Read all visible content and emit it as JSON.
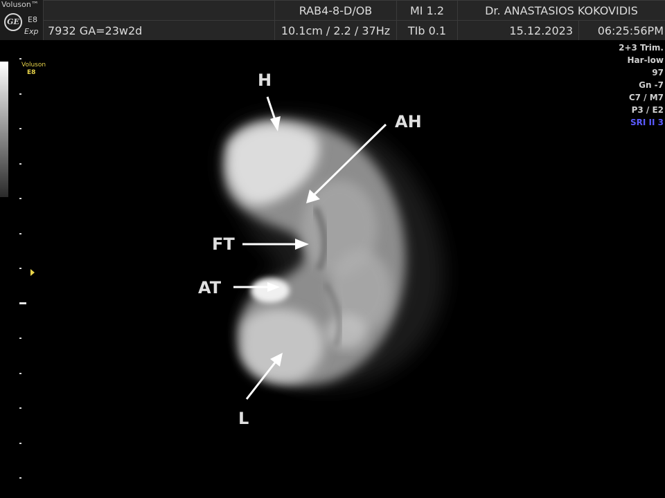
{
  "header": {
    "brand": "Voluson™",
    "ge_logo": "GE",
    "model": "E8",
    "mode": "Exp",
    "patient_info": "7932  GA=23w2d",
    "probe": "RAB4-8-D/OB",
    "scan_params": "10.1cm / 2.2 / 37Hz",
    "mi": "MI  1.2",
    "tib": "TIb  0.1",
    "doctor": "Dr. ANASTASIOS KOKOVIDIS",
    "date": "15.12.2023",
    "time": "06:25:56PM"
  },
  "side_brand": {
    "name": "Voluson",
    "model": "E8"
  },
  "parameters": [
    "2+3 Trim.",
    "Har-low",
    "97",
    "Gn  -7",
    "C7 / M7",
    "P3 / E2",
    "SRI II 3"
  ],
  "annotations": {
    "H": "H",
    "AH": "AH",
    "FT": "FT",
    "AT": "AT",
    "L": "L"
  },
  "colors": {
    "background": "#000000",
    "header_bg": "#262626",
    "accent_yellow": "#e8d44a",
    "sri_blue": "#5b5bff"
  }
}
